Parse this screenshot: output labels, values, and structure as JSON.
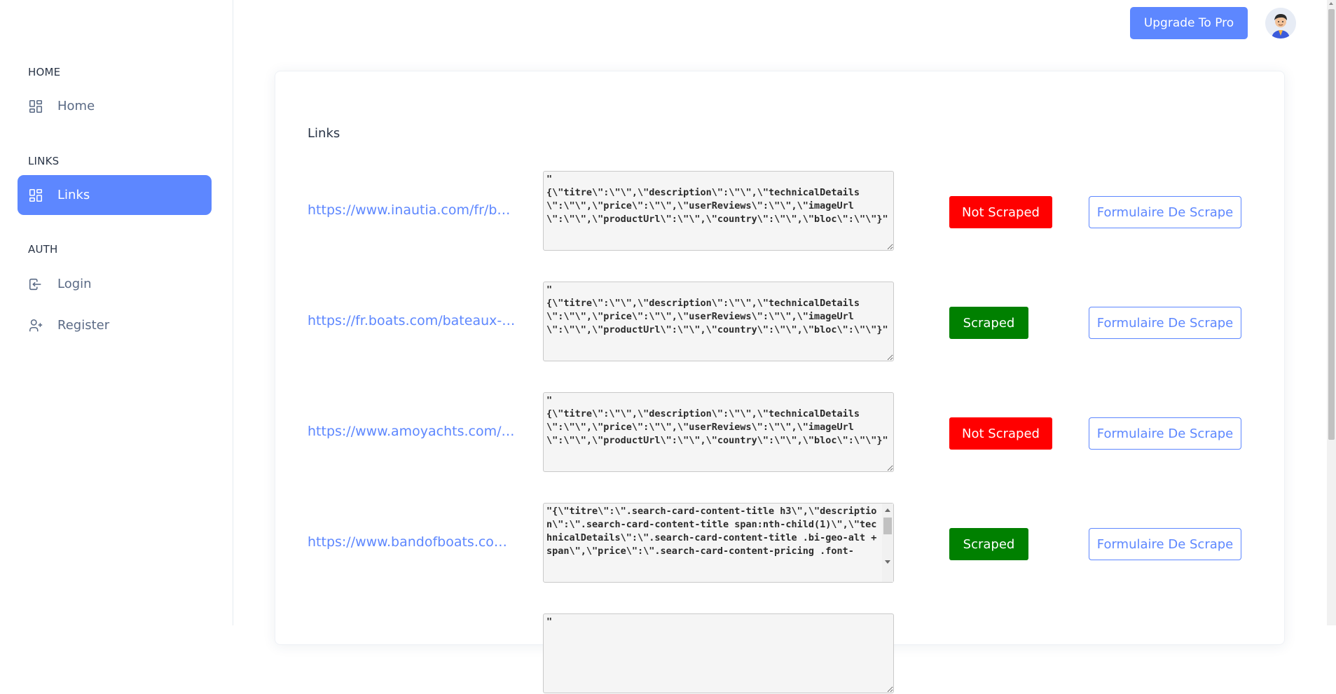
{
  "sidebar": {
    "sections": [
      {
        "caption": "HOME",
        "items": [
          {
            "label": "Home",
            "icon": "layout-dashboard-icon"
          }
        ]
      },
      {
        "caption": "LINKS",
        "items": [
          {
            "label": "Links",
            "icon": "layout-dashboard-icon",
            "active": true
          }
        ]
      },
      {
        "caption": "AUTH",
        "items": [
          {
            "label": "Login",
            "icon": "login-icon"
          },
          {
            "label": "Register",
            "icon": "user-plus-icon"
          }
        ]
      }
    ]
  },
  "header": {
    "upgrade_label": "Upgrade To Pro",
    "avatar_icon": "user-avatar-icon"
  },
  "main": {
    "title": "Links",
    "rows": [
      {
        "url": "https://www.inautia.com/fr/ba…",
        "selectors": "\"\n{\\\"titre\\\":\\\"\\\",\\\"description\\\":\\\"\\\",\\\"technicalDetails\\\":\\\"\\\",\\\"price\\\":\\\"\\\",\\\"userReviews\\\":\\\"\\\",\\\"imageUrl\\\":\\\"\\\",\\\"productUrl\\\":\\\"\\\",\\\"country\\\":\\\"\\\",\\\"bloc\\\":\\\"\\\"}\"",
        "status": "Not Scraped",
        "action": "Formulaire De Scrape"
      },
      {
        "url": "https://fr.boats.com/bateaux-…",
        "selectors": "\"\n{\\\"titre\\\":\\\"\\\",\\\"description\\\":\\\"\\\",\\\"technicalDetails\\\":\\\"\\\",\\\"price\\\":\\\"\\\",\\\"userReviews\\\":\\\"\\\",\\\"imageUrl\\\":\\\"\\\",\\\"productUrl\\\":\\\"\\\",\\\"country\\\":\\\"\\\",\\\"bloc\\\":\\\"\\\"}\"",
        "status": "Scraped",
        "action": "Formulaire De Scrape"
      },
      {
        "url": "https://www.amoyachts.com/f…",
        "selectors": "\"\n{\\\"titre\\\":\\\"\\\",\\\"description\\\":\\\"\\\",\\\"technicalDetails\\\":\\\"\\\",\\\"price\\\":\\\"\\\",\\\"userReviews\\\":\\\"\\\",\\\"imageUrl\\\":\\\"\\\",\\\"productUrl\\\":\\\"\\\",\\\"country\\\":\\\"\\\",\\\"bloc\\\":\\\"\\\"}\"",
        "status": "Not Scraped",
        "action": "Formulaire De Scrape"
      },
      {
        "url": "https://www.bandofboats.co…",
        "selectors": "\"{\\\"titre\\\":\\\".search-card-content-title h3\\\",\\\"description\\\":\\\".search-card-content-title span:nth-child(1)\\\",\\\"technicalDetails\\\":\\\".search-card-content-title .bi-geo-alt + span\\\",\\\"price\\\":\\\".search-card-content-pricing .font-",
        "status": "Scraped",
        "action": "Formulaire De Scrape"
      },
      {
        "url": "",
        "selectors": "\"",
        "status": "",
        "action": ""
      }
    ]
  },
  "colors": {
    "accent": "#5d87ff",
    "not_scraped": "#ff0000",
    "scraped": "#008000"
  }
}
